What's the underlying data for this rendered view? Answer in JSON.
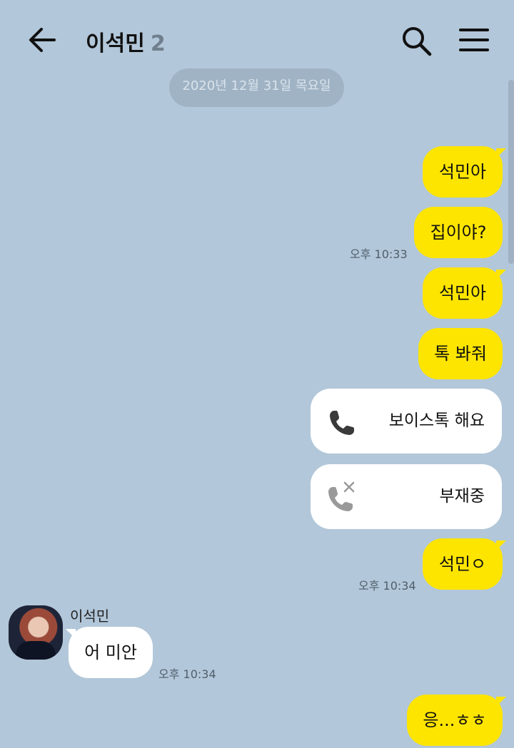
{
  "header": {
    "title": "이석민",
    "member_count": "2",
    "back_icon": "arrow-left-icon",
    "search_icon": "search-icon",
    "menu_icon": "hamburger-menu-icon"
  },
  "date_divider": "2020년 12월 31일 목요일",
  "messages": {
    "m1": "석민아",
    "m2": "집이야?",
    "m2_time": "오후 10:33",
    "m3": "석민아",
    "m4": "톡 봐줘",
    "call1": {
      "label": "보이스톡 해요",
      "icon": "phone-icon"
    },
    "call2": {
      "label": "부재중",
      "icon": "missed-call-icon"
    },
    "m5": "석민ㅇ",
    "m5_time": "오후 10:34",
    "other_name": "이석민",
    "other_msg": "어 미안",
    "other_time": "오후 10:34",
    "m6": "응...ㅎㅎ"
  },
  "colors": {
    "background": "#b2c7d9",
    "my_bubble": "#fee500",
    "other_bubble": "#ffffff",
    "date_pill": "#a0b3c4"
  }
}
